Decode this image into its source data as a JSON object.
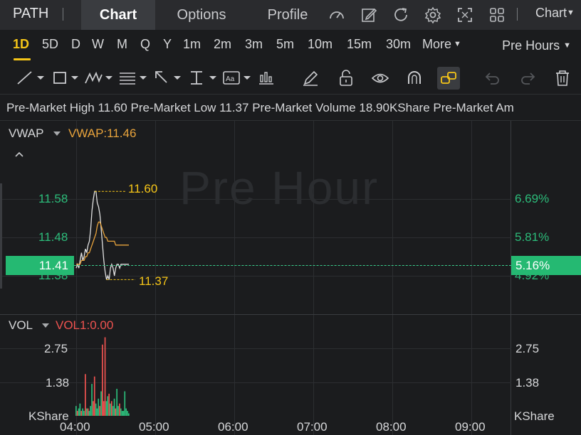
{
  "topnav": {
    "ticker": "PATH",
    "tabs": [
      "Chart",
      "Options",
      "Profile"
    ],
    "icons": [
      "gauge-icon",
      "edit-icon",
      "refresh-icon",
      "settings-icon",
      "fullscreen-icon",
      "grid-icon"
    ],
    "chart_menu": "Chart"
  },
  "periods": {
    "items": [
      "1D",
      "5D",
      "D",
      "W",
      "M",
      "Q",
      "Y",
      "1m",
      "2m",
      "3m",
      "5m",
      "10m",
      "15m",
      "30m",
      "More"
    ],
    "active": "1D",
    "session": "Pre Hours"
  },
  "toolbar": {
    "tools": [
      "trend-line-icon",
      "rectangle-icon",
      "pattern-icon",
      "fibonacci-icon",
      "arrow-icon",
      "measure-icon",
      "text-icon",
      "indicator-icon",
      "pen-icon",
      "lock-icon",
      "eye-icon",
      "magnet-icon",
      "link-icon",
      "undo-icon",
      "redo-icon",
      "trash-icon"
    ],
    "active_tool": "link-icon"
  },
  "info": {
    "text": "Pre-Market High 11.60 Pre-Market Low 11.37 Pre-Market Volume 18.90KShare Pre-Market Am"
  },
  "price_pane": {
    "indicator": "VWAP",
    "indicator_value": "VWAP:11.46",
    "watermark": "Pre Hour",
    "price_ticks": [
      "11.58",
      "11.48",
      "11.38"
    ],
    "pct_ticks": [
      "6.69%",
      "5.81%",
      "4.92%"
    ],
    "last_price": "11.41",
    "last_pct": "5.16%",
    "high_label": "11.60",
    "low_label": "11.37"
  },
  "volume_pane": {
    "indicator": "VOL",
    "indicator_value": "VOL1:0.00",
    "ticks_left": [
      "2.75",
      "1.38",
      "KShare"
    ],
    "ticks_right": [
      "2.75",
      "1.38",
      "KShare"
    ]
  },
  "time_axis": [
    "04:00",
    "05:00",
    "06:00",
    "07:00",
    "08:00",
    "09:00"
  ],
  "colors": {
    "up": "#2cbc7a",
    "down": "#ef5350",
    "vwap": "#e8a33c",
    "accent": "#f5c518",
    "price_line": "#e0e0e0"
  },
  "chart_data": {
    "type": "line",
    "x": [
      "04:00",
      "04:01",
      "04:02",
      "04:03",
      "04:04",
      "04:05",
      "04:06",
      "04:07",
      "04:08",
      "04:09",
      "04:10",
      "04:11",
      "04:12",
      "04:13",
      "04:14",
      "04:15",
      "04:16",
      "04:17",
      "04:18",
      "04:19",
      "04:20",
      "04:21",
      "04:22",
      "04:23",
      "04:24",
      "04:25",
      "04:26",
      "04:27",
      "04:28",
      "04:29",
      "04:30",
      "04:31",
      "04:32",
      "04:33",
      "04:34",
      "04:35",
      "04:36",
      "04:37",
      "04:38",
      "04:39",
      "04:40"
    ],
    "series": [
      {
        "values": [
          11.4,
          11.41,
          11.4,
          11.42,
          11.44,
          11.42,
          11.43,
          11.45,
          11.44,
          11.46,
          11.47,
          11.5,
          11.55,
          11.58,
          11.6,
          11.6,
          11.57,
          11.56,
          11.54,
          11.5,
          11.46,
          11.42,
          11.39,
          11.37,
          11.38,
          11.37,
          11.4,
          11.41,
          11.4,
          11.38,
          11.4,
          11.41,
          11.41,
          11.4,
          11.41,
          11.41,
          11.41,
          11.41,
          11.41,
          11.41,
          11.41
        ]
      },
      {
        "name": "VWAP",
        "values": [
          11.41,
          11.41,
          11.41,
          11.41,
          11.42,
          11.42,
          11.42,
          11.43,
          11.43,
          11.44,
          11.44,
          11.45,
          11.46,
          11.47,
          11.48,
          11.49,
          11.51,
          11.52,
          11.52,
          11.51,
          11.5,
          11.49,
          11.48,
          11.48,
          11.47,
          11.47,
          11.47,
          11.47,
          11.47,
          11.47,
          11.46,
          11.46,
          11.46,
          11.46,
          11.46,
          11.46,
          11.46,
          11.46,
          11.46,
          11.46,
          11.46
        ]
      }
    ],
    "high": 11.6,
    "low": 11.37,
    "last": 11.41,
    "ylim": [
      11.33,
      11.65
    ],
    "volume": {
      "unit": "KShare",
      "ylim": [
        0,
        3.3
      ],
      "bars": [
        {
          "t": "04:00",
          "v": 0.4,
          "dir": "up"
        },
        {
          "t": "04:01",
          "v": 0.2,
          "dir": "down"
        },
        {
          "t": "04:02",
          "v": 0.3,
          "dir": "up"
        },
        {
          "t": "04:03",
          "v": 0.5,
          "dir": "up"
        },
        {
          "t": "04:04",
          "v": 0.2,
          "dir": "down"
        },
        {
          "t": "04:05",
          "v": 0.3,
          "dir": "up"
        },
        {
          "t": "04:06",
          "v": 0.2,
          "dir": "up"
        },
        {
          "t": "04:07",
          "v": 1.7,
          "dir": "down"
        },
        {
          "t": "04:08",
          "v": 0.3,
          "dir": "up"
        },
        {
          "t": "04:09",
          "v": 0.3,
          "dir": "down"
        },
        {
          "t": "04:10",
          "v": 0.2,
          "dir": "up"
        },
        {
          "t": "04:11",
          "v": 0.4,
          "dir": "up"
        },
        {
          "t": "04:12",
          "v": 1.3,
          "dir": "up"
        },
        {
          "t": "04:13",
          "v": 0.6,
          "dir": "down"
        },
        {
          "t": "04:14",
          "v": 1.6,
          "dir": "down"
        },
        {
          "t": "04:15",
          "v": 0.5,
          "dir": "up"
        },
        {
          "t": "04:16",
          "v": 0.3,
          "dir": "up"
        },
        {
          "t": "04:17",
          "v": 0.7,
          "dir": "up"
        },
        {
          "t": "04:18",
          "v": 0.4,
          "dir": "down"
        },
        {
          "t": "04:19",
          "v": 1.0,
          "dir": "up"
        },
        {
          "t": "04:20",
          "v": 2.9,
          "dir": "down"
        },
        {
          "t": "04:21",
          "v": 0.6,
          "dir": "down"
        },
        {
          "t": "04:22",
          "v": 3.2,
          "dir": "down"
        },
        {
          "t": "04:23",
          "v": 0.6,
          "dir": "up"
        },
        {
          "t": "04:24",
          "v": 0.8,
          "dir": "up"
        },
        {
          "t": "04:25",
          "v": 0.9,
          "dir": "down"
        },
        {
          "t": "04:26",
          "v": 0.5,
          "dir": "up"
        },
        {
          "t": "04:27",
          "v": 0.6,
          "dir": "down"
        },
        {
          "t": "04:28",
          "v": 0.4,
          "dir": "up"
        },
        {
          "t": "04:29",
          "v": 0.7,
          "dir": "up"
        },
        {
          "t": "04:30",
          "v": 0.3,
          "dir": "down"
        },
        {
          "t": "04:31",
          "v": 1.1,
          "dir": "up"
        },
        {
          "t": "04:32",
          "v": 0.4,
          "dir": "up"
        },
        {
          "t": "04:33",
          "v": 0.5,
          "dir": "down"
        },
        {
          "t": "04:34",
          "v": 0.3,
          "dir": "up"
        },
        {
          "t": "04:35",
          "v": 0.2,
          "dir": "up"
        },
        {
          "t": "04:36",
          "v": 0.2,
          "dir": "up"
        },
        {
          "t": "04:37",
          "v": 1.0,
          "dir": "up"
        },
        {
          "t": "04:38",
          "v": 0.3,
          "dir": "up"
        },
        {
          "t": "04:39",
          "v": 0.2,
          "dir": "up"
        },
        {
          "t": "04:40",
          "v": 0.1,
          "dir": "up"
        }
      ]
    }
  }
}
